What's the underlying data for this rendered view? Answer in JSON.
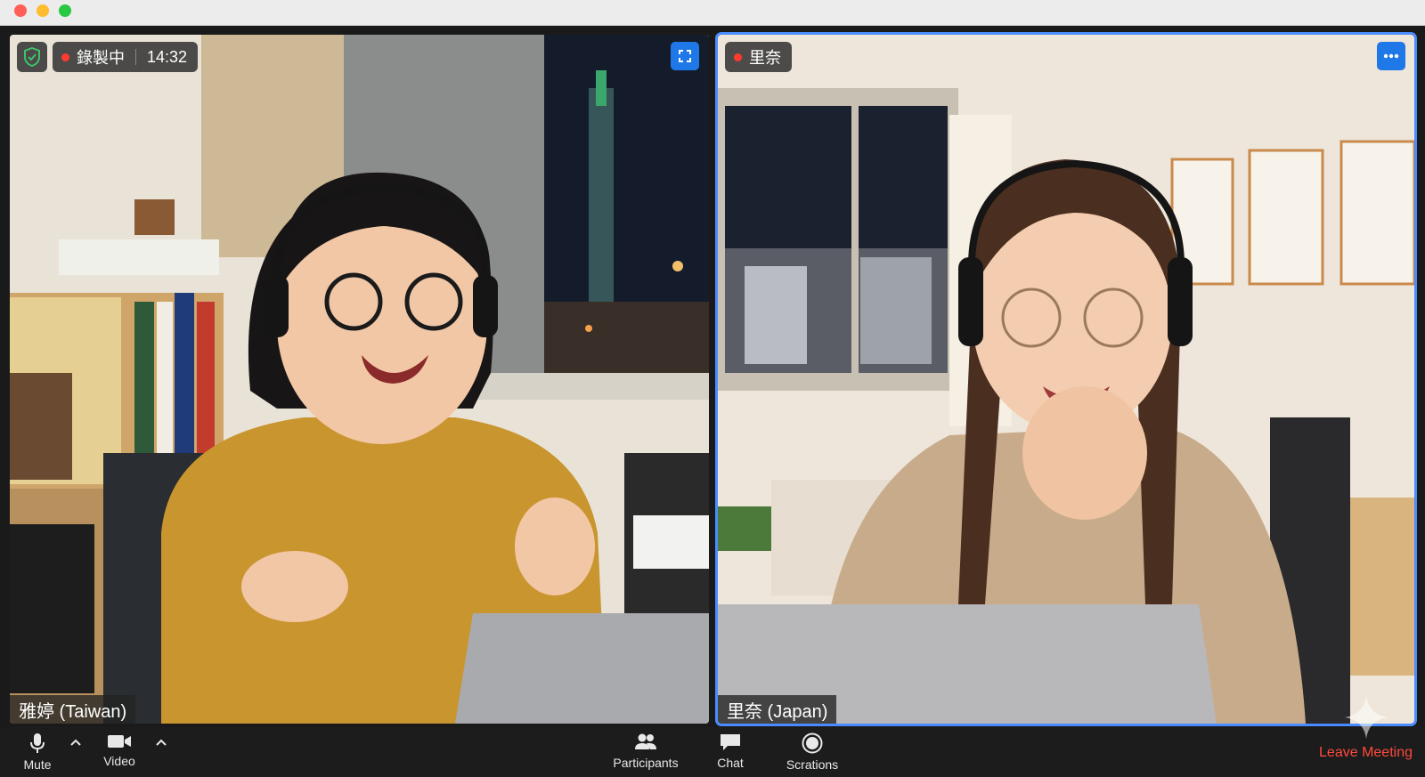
{
  "window": {
    "buttons": [
      "close",
      "minimize",
      "maximize"
    ]
  },
  "left_tile": {
    "security_icon": "shield-check-icon",
    "recording_label": "錄製中",
    "recording_time": "14:32",
    "fullscreen_icon": "expand-icon",
    "participant_name": "雅婷 (Taiwan)"
  },
  "right_tile": {
    "top_badge": "里奈",
    "more_icon": "more-horizontal-icon",
    "participant_name": "里奈 (Japan)",
    "active_speaker_color": "#4a8cff"
  },
  "toolbar": {
    "mute_label": "Mute",
    "video_label": "Video",
    "participants_label": "Participants",
    "chat_label": "Chat",
    "recording_label": "Scrations",
    "leave_label": "Leave Meeting",
    "leave_color": "#ff4a3d"
  }
}
